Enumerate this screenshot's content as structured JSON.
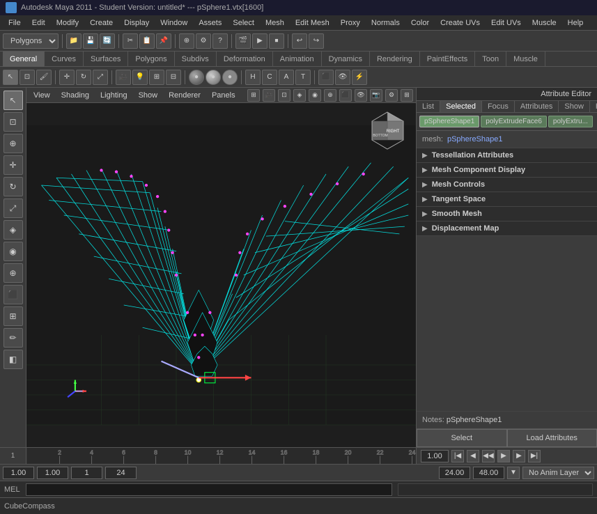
{
  "app": {
    "title": "Autodesk Maya 2011 - Student Version: untitled* --- pSphere1.vtx[1600]",
    "icon": "maya-icon"
  },
  "menubar": {
    "items": [
      "File",
      "Edit",
      "Modify",
      "Create",
      "Display",
      "Window",
      "Assets",
      "Select",
      "Mesh",
      "Edit Mesh",
      "Proxy",
      "Normals",
      "Color",
      "Create UVs",
      "Edit UVs",
      "Muscle",
      "Help"
    ]
  },
  "toolbar": {
    "dropdown_label": "Polygons"
  },
  "tabs": {
    "items": [
      "General",
      "Curves",
      "Surfaces",
      "Polygons",
      "Subdivs",
      "Deformation",
      "Animation",
      "Dynamics",
      "Rendering",
      "PaintEffects",
      "Toon",
      "Muscle"
    ],
    "active": "General"
  },
  "viewport": {
    "menu_items": [
      "View",
      "Shading",
      "Lighting",
      "Show",
      "Renderer",
      "Panels"
    ],
    "orient_labels": [
      "RIGHT",
      "BOTTOM"
    ]
  },
  "attribute_editor": {
    "title": "Attribute Editor",
    "tab_items": [
      "List",
      "Selected",
      "Focus",
      "Attributes",
      "Show",
      "Help"
    ],
    "nodes": [
      "pSphereShape1",
      "polyExtrudeFace6",
      "polyExtru..."
    ],
    "active_node": "pSphereShape1",
    "mesh_key": "mesh:",
    "mesh_value": "pSphereShape1",
    "sections": [
      {
        "id": "tessellation",
        "label": "Tessellation Attributes"
      },
      {
        "id": "mesh-component",
        "label": "Mesh Component Display"
      },
      {
        "id": "mesh-controls",
        "label": "Mesh Controls"
      },
      {
        "id": "tangent-space",
        "label": "Tangent Space"
      },
      {
        "id": "smooth-mesh",
        "label": "Smooth Mesh"
      },
      {
        "id": "displacement-map",
        "label": "Displacement Map"
      }
    ],
    "notes_label": "Notes:",
    "notes_value": "pSphereShape1",
    "select_btn": "Select",
    "load_btn": "Load Attributes"
  },
  "timeline": {
    "start": 1,
    "end": 24,
    "ticks": [
      2,
      4,
      6,
      8,
      10,
      12,
      14,
      16,
      18,
      20,
      22,
      24
    ]
  },
  "bottom_controls": {
    "current_frame_left": "1.00",
    "field2": "1.00",
    "field3": "1",
    "field4": "24",
    "time_right": "24.00",
    "time_end": "48.00",
    "anim_layer": "No Anim Layer"
  },
  "statusbar": {
    "mel_label": "MEL",
    "mel_placeholder": ""
  },
  "compass": {
    "label": "CubeCompass"
  }
}
